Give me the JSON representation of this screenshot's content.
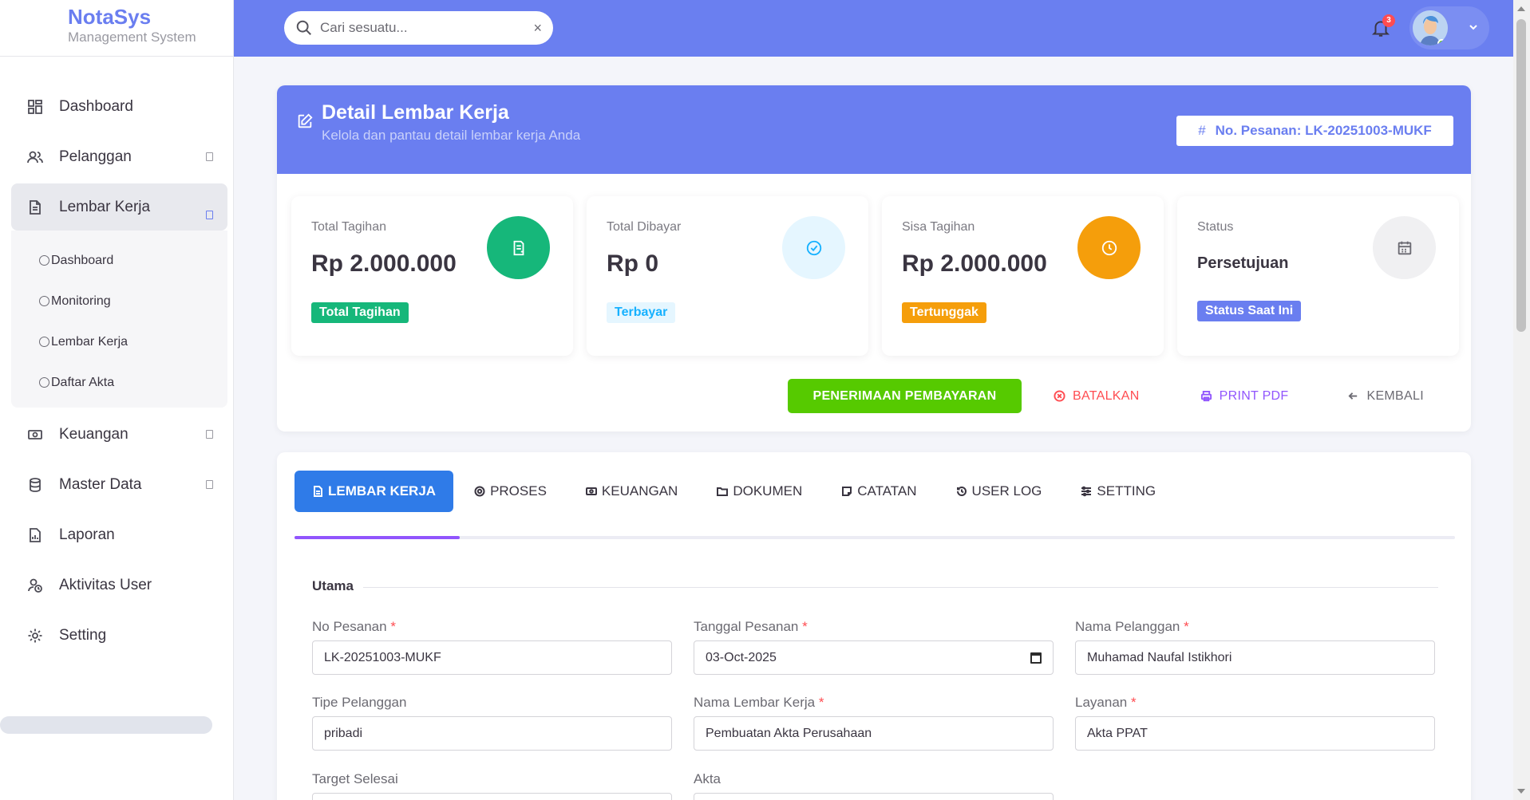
{
  "brand": {
    "name": "NotaSys",
    "subtitle": "Management System"
  },
  "sidebar": {
    "items": [
      {
        "label": "Dashboard",
        "icon": "dashboard-icon"
      },
      {
        "label": "Pelanggan",
        "icon": "users-icon"
      },
      {
        "label": "Lembar Kerja",
        "icon": "document-icon",
        "active": true
      },
      {
        "label": "Keuangan",
        "icon": "money-icon"
      },
      {
        "label": "Master Data",
        "icon": "database-icon"
      },
      {
        "label": "Laporan",
        "icon": "report-icon"
      },
      {
        "label": "Aktivitas User",
        "icon": "user-activity-icon"
      },
      {
        "label": "Setting",
        "icon": "gear-icon"
      }
    ],
    "subitems": [
      "Dashboard",
      "Monitoring",
      "Lembar Kerja",
      "Daftar Akta"
    ]
  },
  "topbar": {
    "search_placeholder": "Cari sesuatu...",
    "clear_symbol": "×",
    "notification_count": "3"
  },
  "hero": {
    "title": "Detail Lembar Kerja",
    "description": "Kelola dan pantau detail lembar kerja Anda",
    "order_hash": "#",
    "order_label": "No. Pesanan: LK-20251003-MUKF"
  },
  "stats": [
    {
      "label": "Total Tagihan",
      "value": "Rp 2.000.000",
      "pill": "Total Tagihan",
      "color": "#16b77a",
      "icon": "receipt-icon"
    },
    {
      "label": "Total Dibayar",
      "value": "Rp 0",
      "pill": "Terbayar",
      "color": "#16b1ff",
      "icon": "check-circle-icon"
    },
    {
      "label": "Sisa Tagihan",
      "value": "Rp 2.000.000",
      "pill": "Tertunggak",
      "color": "#f59e0b",
      "icon": "clock-icon"
    },
    {
      "label": "Status",
      "value": "Persetujuan",
      "pill": "Status Saat Ini",
      "color": "#6a7ef0",
      "icon": "calendar-icon"
    }
  ],
  "actions": {
    "primary": "PENERIMAAN PEMBAYARAN",
    "cancel": "BATALKAN",
    "print": "PRINT PDF",
    "back": "KEMBALI"
  },
  "tabs": [
    "LEMBAR KERJA",
    "PROSES",
    "KEUANGAN",
    "DOKUMEN",
    "CATATAN",
    "USER LOG",
    "SETTING"
  ],
  "form": {
    "section": "Utama",
    "fields": {
      "no_pesanan": {
        "label": "No Pesanan",
        "value": "LK-20251003-MUKF",
        "required": "*"
      },
      "tanggal_pesanan": {
        "label": "Tanggal Pesanan",
        "value": "03-Oct-2025",
        "required": "*"
      },
      "nama_pelanggan": {
        "label": "Nama Pelanggan",
        "value": "Muhamad Naufal Istikhori",
        "required": "*"
      },
      "tipe_pelanggan": {
        "label": "Tipe Pelanggan",
        "value": "pribadi"
      },
      "nama_lembar_kerja": {
        "label": "Nama Lembar Kerja",
        "value": "Pembuatan Akta Perusahaan",
        "required": "*"
      },
      "layanan": {
        "label": "Layanan",
        "value": "Akta PPAT",
        "required": "*"
      },
      "target_selesai": {
        "label": "Target Selesai",
        "value": ""
      },
      "akta": {
        "label": "Akta",
        "value": ""
      }
    }
  },
  "colors": {
    "accent": "#6a7ef0",
    "success": "#56ca00",
    "danger": "#ff4c51",
    "print": "#9155fd",
    "tab_active": "#2f7be8"
  }
}
